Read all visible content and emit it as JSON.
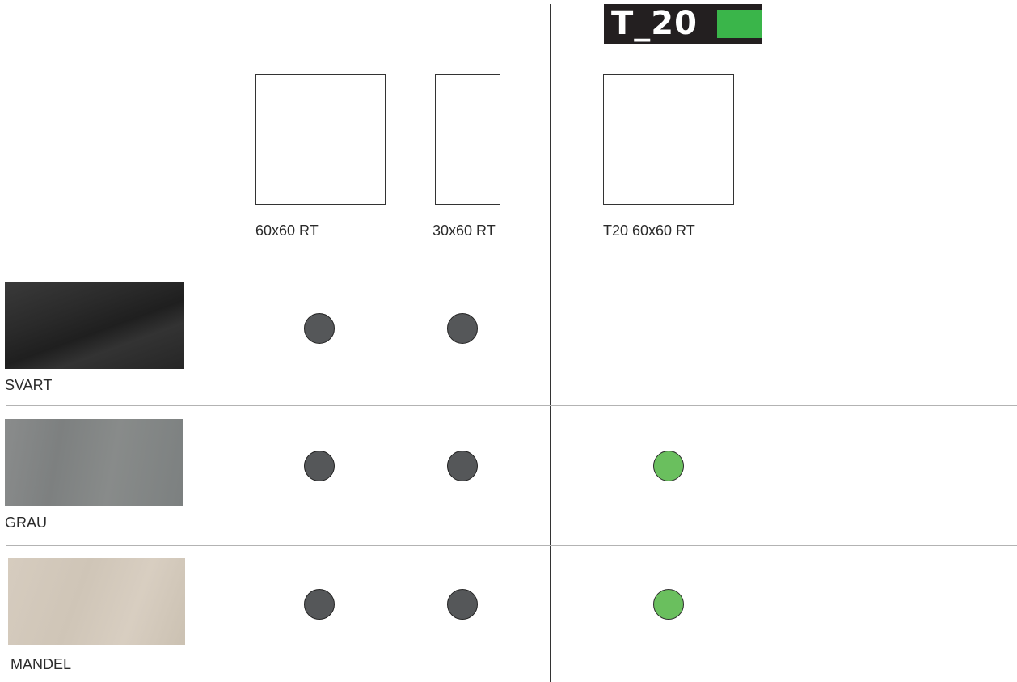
{
  "logo": {
    "text": "T_20",
    "accent_color": "#3ab54a"
  },
  "formats": [
    {
      "label": "60x60 RT"
    },
    {
      "label": "30x60 RT"
    },
    {
      "label": "T20 60x60 RT"
    }
  ],
  "colors": [
    {
      "name": "SVART",
      "available": {
        "60x60 RT": true,
        "30x60 RT": true,
        "T20 60x60 RT": false
      }
    },
    {
      "name": "GRAU",
      "available": {
        "60x60 RT": true,
        "30x60 RT": true,
        "T20 60x60 RT": true
      }
    },
    {
      "name": "MANDEL",
      "available": {
        "60x60 RT": true,
        "30x60 RT": true,
        "T20 60x60 RT": true
      }
    }
  ],
  "dot_colors": {
    "standard": "#555759",
    "t20": "#6abf5e"
  }
}
